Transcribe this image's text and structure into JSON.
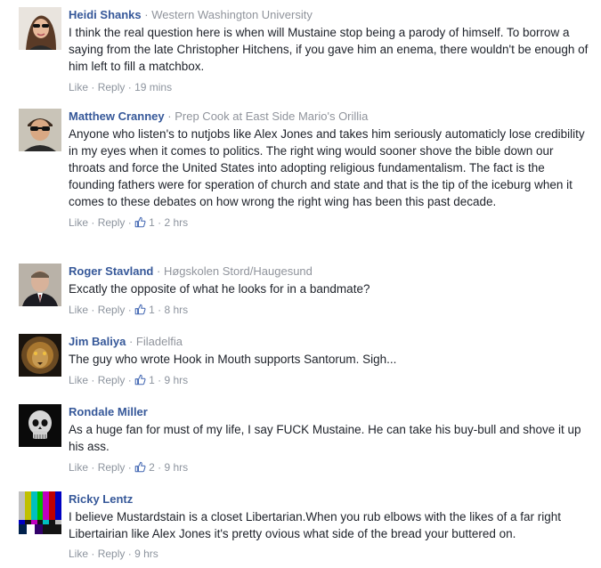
{
  "comments": [
    {
      "name": "Heidi Shanks",
      "affiliation": "Western Washington University",
      "text": "I think the real question here is when will Mustaine stop being a parody of himself. To borrow a saying from the late Christopher Hitchens, if you gave him an enema, there wouldn't be enough of him left to fill a matchbox.",
      "like": "Like",
      "reply": "Reply",
      "likes": "",
      "time": "19 mins",
      "avatar": "woman-sunglasses-avatar"
    },
    {
      "name": "Matthew Cranney",
      "affiliation": "Prep Cook at East Side Mario's Orillia",
      "text": "Anyone who listen's to nutjobs like Alex Jones and takes him seriously automaticly lose credibility in my eyes when it comes to politics. The right wing would sooner shove the bible down our throats and force the United States into adopting religious fundamentalism. The fact is the founding fathers were for speration of church and state and that is the tip of the iceburg when it comes to these debates on how wrong the right wing has been this past decade.",
      "like": "Like",
      "reply": "Reply",
      "likes": "1",
      "time": "2 hrs",
      "avatar": "man-sunglasses-avatar"
    },
    {
      "name": "Roger Stavland",
      "affiliation": "Høgskolen Stord/Haugesund",
      "text": "Excatly the opposite of what he looks for in a bandmate?",
      "like": "Like",
      "reply": "Reply",
      "likes": "1",
      "time": "8 hrs",
      "avatar": "man-suit-avatar"
    },
    {
      "name": "Jim Baliya",
      "affiliation": "Filadelfia",
      "text": "The guy who wrote Hook in Mouth supports Santorum. Sigh...",
      "like": "Like",
      "reply": "Reply",
      "likes": "1",
      "time": "9 hrs",
      "avatar": "lion-avatar"
    },
    {
      "name": "Rondale Miller",
      "affiliation": "",
      "text": "As a huge fan for must of my life, I say FUCK Mustaine. He can take his buy-bull and shove it up his ass.",
      "like": "Like",
      "reply": "Reply",
      "likes": "2",
      "time": "9 hrs",
      "avatar": "skull-avatar"
    },
    {
      "name": "Ricky Lentz",
      "affiliation": "",
      "text": "I believe Mustardstain is a closet Libertarian.When you rub elbows with the likes of a far right Libertairian like Alex Jones it's pretty ovious what side of the bread your buttered on.",
      "like": "Like",
      "reply": "Reply",
      "likes": "",
      "time": "9 hrs",
      "avatar": "color-bars-avatar"
    }
  ],
  "separators": {
    "dot": "·"
  }
}
